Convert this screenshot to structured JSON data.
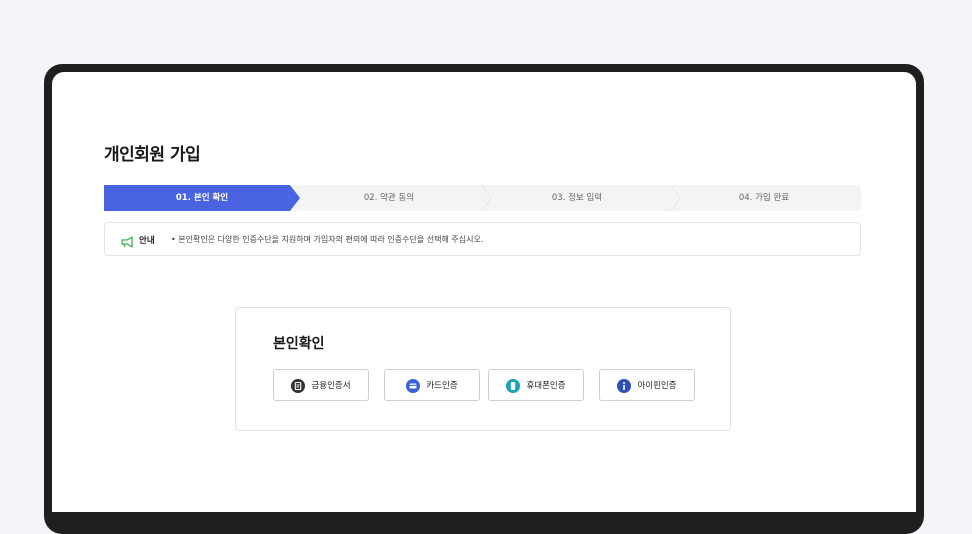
{
  "page": {
    "title": "개인회원 가입"
  },
  "steps": [
    {
      "label": "01. 본인 확인",
      "active": true
    },
    {
      "label": "02. 약관 동의",
      "active": false
    },
    {
      "label": "03. 정보 입력",
      "active": false
    },
    {
      "label": "04. 가입 완료",
      "active": false
    }
  ],
  "notice": {
    "icon": "megaphone-icon",
    "label": "안내",
    "text": "• 본인확인은 다양한 인증수단을 지원하며 가입자의 편의에 따라 인증수단을 선택해 주십시오."
  },
  "verification": {
    "title": "본인확인",
    "methods": [
      {
        "label": "금융인증서",
        "icon": "certificate-icon",
        "color": "#333333"
      },
      {
        "label": "카드인증",
        "icon": "card-icon",
        "color": "#3b63d9"
      },
      {
        "label": "휴대폰인증",
        "icon": "phone-icon",
        "color": "#1aa3b8"
      },
      {
        "label": "아이핀인증",
        "icon": "info-icon",
        "color": "#2f4fb8"
      }
    ]
  },
  "colors": {
    "accent": "#4a63e0",
    "step_inactive": "#f3f4f6"
  }
}
